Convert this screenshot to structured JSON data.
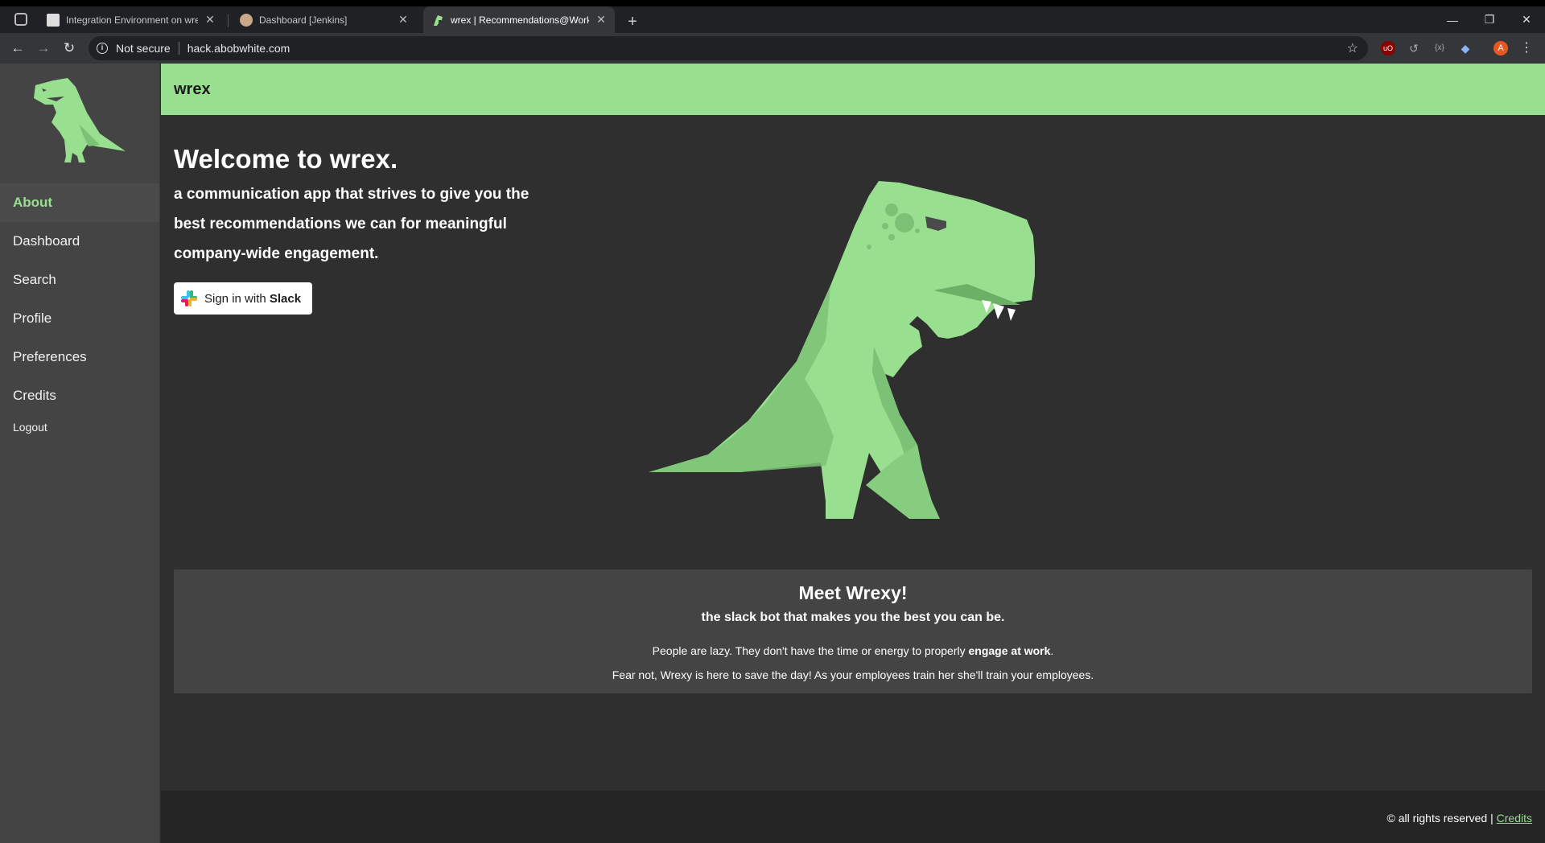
{
  "browser": {
    "tabs": [
      {
        "title": "Integration Environment on wrex",
        "active": false
      },
      {
        "title": "Dashboard [Jenkins]",
        "active": false
      },
      {
        "title": "wrex | Recommendations@Work",
        "active": true
      }
    ],
    "security_label": "Not secure",
    "url": "hack.abobwhite.com",
    "profile_initial": "A",
    "ublock_label": "uO"
  },
  "sidebar": {
    "items": [
      {
        "label": "About",
        "active": true
      },
      {
        "label": "Dashboard"
      },
      {
        "label": "Search"
      },
      {
        "label": "Profile"
      },
      {
        "label": "Preferences"
      },
      {
        "label": "Credits"
      },
      {
        "label": "Logout"
      }
    ]
  },
  "header": {
    "brand": "wrex"
  },
  "hero": {
    "title": "Welcome to wrex.",
    "subtitle": "a communication app that strives to give you the best recommendations we can for meaningful company-wide engagement.",
    "slack_button": {
      "prefix": "Sign in with ",
      "brand": "Slack"
    }
  },
  "card": {
    "title": "Meet Wrexy!",
    "subtitle": "the slack bot that makes you the best you can be.",
    "line1_pre": "People are lazy. They don't have the time or energy to properly ",
    "line1_bold": "engage at work",
    "line1_post": ".",
    "line2": "Fear not, Wrexy is here to save the day! As your employees train her she'll train your employees."
  },
  "footer": {
    "text": "© all rights reserved | ",
    "link": "Credits"
  },
  "colors": {
    "accent": "#98e08f",
    "sidebar": "#444444",
    "background": "#2f2f2f"
  }
}
